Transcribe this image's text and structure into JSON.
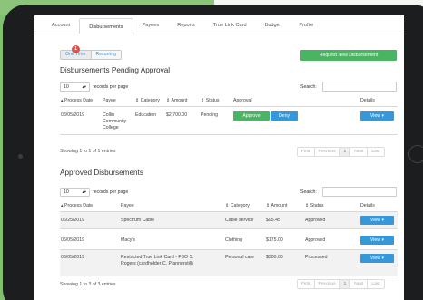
{
  "tabs": [
    "Account",
    "Disbursements",
    "Payees",
    "Reports",
    "True Link Card",
    "Budget",
    "Profile"
  ],
  "subtabs": {
    "one_time": "One Time",
    "recurring": "Recurring",
    "badge": "1"
  },
  "request_button": "Request New Disbursement",
  "pending": {
    "title": "Disbursements Pending Approval",
    "page_size": "10",
    "records_label": "records per page",
    "search_label": "Search:",
    "headers": [
      "Process Date",
      "Payee",
      "Category",
      "Amount",
      "Status",
      "Approval",
      "Details"
    ],
    "row": {
      "date": "08/05/2019",
      "payee_l1": "Collin",
      "payee_l2": "Community",
      "payee_l3": "College",
      "category": "Education",
      "amount": "$2,700.00",
      "status": "Pending"
    },
    "approve": "Approve",
    "deny": "Deny",
    "view": "View",
    "info": "Showing 1 to 1 of 1 entries",
    "pager": [
      "First",
      "Previous",
      "1",
      "Next",
      "Last"
    ]
  },
  "approved": {
    "title": "Approved Disbursements",
    "page_size": "10",
    "records_label": "records per page",
    "search_label": "Search:",
    "headers": [
      "Process Date",
      "Payee",
      "Category",
      "Amount",
      "Status",
      "Details"
    ],
    "rows": [
      {
        "date": "06/25/2019",
        "payee": "Spectrum Cable",
        "payee2": "",
        "category": "Cable service",
        "amount": "$95.45",
        "status": "Approved"
      },
      {
        "date": "06/05/2019",
        "payee": "Macy's",
        "payee2": "",
        "category": "Clothing",
        "amount": "$175.00",
        "status": "Approved"
      },
      {
        "date": "06/05/2019",
        "payee": "Restricted True Link Card - FBO S.",
        "payee2": "Rogers (cardholder C. Pfannerstill)",
        "category": "Personal care",
        "amount": "$300.00",
        "status": "Processed"
      }
    ],
    "view": "View",
    "info": "Showing 1 to 3 of 3 entries",
    "pager": [
      "First",
      "Previous",
      "1",
      "Next",
      "Last"
    ]
  }
}
